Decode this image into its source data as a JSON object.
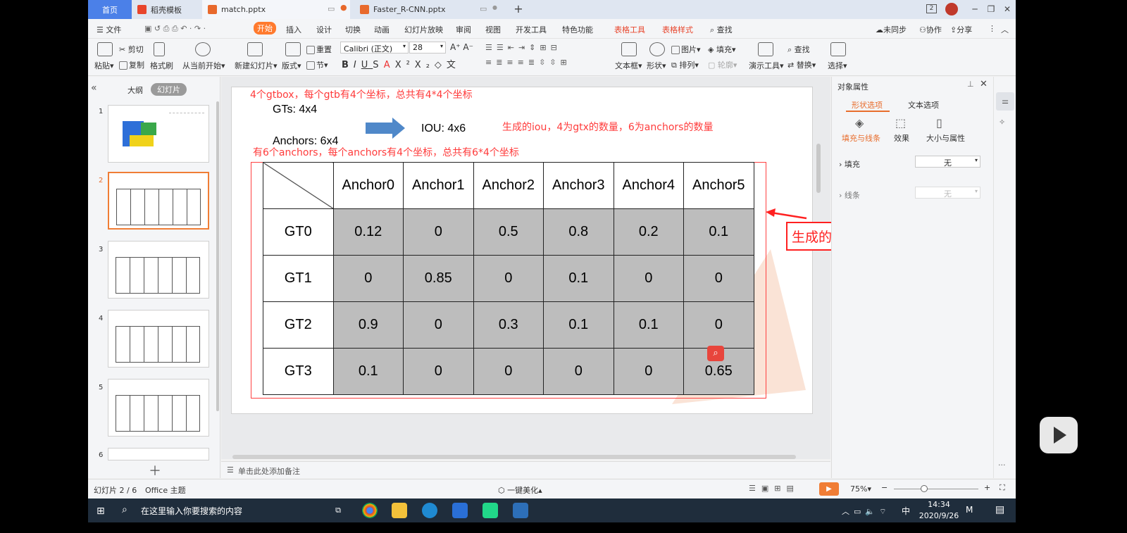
{
  "tabs": {
    "home": "首页",
    "templates": "稻壳模板",
    "active": "match.pptx",
    "second": "Faster_R-CNN.pptx"
  },
  "window": {
    "count": "2"
  },
  "menu": {
    "file": "文件",
    "start": "开始",
    "insert": "插入",
    "design": "设计",
    "transition": "切换",
    "animation": "动画",
    "slideshow": "幻灯片放映",
    "review": "审阅",
    "view": "视图",
    "developer": "开发工具",
    "features": "特色功能",
    "table_tools": "表格工具",
    "table_style": "表格样式",
    "search": "查找",
    "sync": "未同步",
    "collab": "协作",
    "share": "分享"
  },
  "ribbon": {
    "paste": "粘贴",
    "cut": "剪切",
    "copy": "复制",
    "format_painter": "格式刷",
    "from_current": "从当前开始",
    "new_slide": "新建幻灯片",
    "layout": "版式",
    "reset": "重置",
    "section": "节",
    "font_name": "Calibri (正文)",
    "font_size": "28",
    "textbox": "文本框",
    "shape": "形状",
    "picture": "图片",
    "fill": "填充",
    "arrange": "排列",
    "outline": "轮廓",
    "presentation_tools": "演示工具",
    "find": "查找",
    "replace": "替换",
    "select": "选择"
  },
  "left_panel": {
    "outline_tab": "大纲",
    "slides_tab": "幻灯片",
    "slide_numbers": [
      "1",
      "2",
      "3",
      "4",
      "5",
      "6"
    ]
  },
  "slide": {
    "note_gtbox": "4个gtbox，每个gtb有4个坐标，总共有4*4个坐标",
    "gts": "GTs: 4x4",
    "iou": "IOU: 4x6",
    "note_iou": "生成的iou，4为gtx的数量，6为anchors的数量",
    "anchors": "Anchors: 6x4",
    "note_anchors": "有6个anchors，每个anchors有4个坐标，总共有6*4个坐标",
    "callout": "生成的match_quality_matrix"
  },
  "table": {
    "headers": [
      "Anchor0",
      "Anchor1",
      "Anchor2",
      "Anchor3",
      "Anchor4",
      "Anchor5"
    ],
    "rows": [
      {
        "label": "GT0",
        "values": [
          "0.12",
          "0",
          "0.5",
          "0.8",
          "0.2",
          "0.1"
        ]
      },
      {
        "label": "GT1",
        "values": [
          "0",
          "0.85",
          "0",
          "0.1",
          "0",
          "0"
        ]
      },
      {
        "label": "GT2",
        "values": [
          "0.9",
          "0",
          "0.3",
          "0.1",
          "0.1",
          "0"
        ]
      },
      {
        "label": "GT3",
        "values": [
          "0.1",
          "0",
          "0",
          "0",
          "0",
          "0.65"
        ]
      }
    ]
  },
  "right_panel": {
    "title": "对象属性",
    "tab_shape": "形状选项",
    "tab_text": "文本选项",
    "sub_fill_line": "填充与线条",
    "sub_effects": "效果",
    "sub_size": "大小与属性",
    "fill_label": "填充",
    "fill_value": "无",
    "line_label": "线条",
    "line_value": "无"
  },
  "notes": {
    "placeholder": "单击此处添加备注"
  },
  "status": {
    "slide_counter": "幻灯片 2 / 6",
    "theme": "Office 主题",
    "beautify": "一键美化",
    "zoom": "75%"
  },
  "taskbar": {
    "search_placeholder": "在这里输入你要搜索的内容",
    "ime": "中",
    "time": "14:34",
    "date": "2020/9/26"
  },
  "colors": {
    "accent": "#e86d2c",
    "annotation_red": "#ff3b3b",
    "cell_gray": "#bdbdbd",
    "arrow_blue": "#4f88c9",
    "tab_blue": "#4b80e8"
  }
}
